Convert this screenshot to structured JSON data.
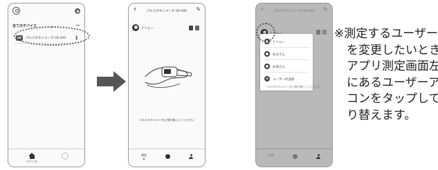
{
  "screen1": {
    "all_devices_label": "全てのデバイス",
    "device_name": "パルスオキシメータ OX-400",
    "bluetooth_icon": "bluetooth-icon",
    "nav": [
      {
        "label": "デバイス",
        "icon": "home-icon"
      },
      {
        "label": "",
        "icon": "user-icon"
      }
    ]
  },
  "screen2": {
    "title": "パルスオキシメータ OX-400",
    "user_name": "ドリムー",
    "instruction": "パルスオキシメータに指を挿入してください",
    "tabs": [
      {
        "label": "測定",
        "icon": "measure-icon"
      },
      {
        "label": "",
        "icon": "info-icon"
      },
      {
        "label": "",
        "icon": "person-icon"
      }
    ]
  },
  "screen3": {
    "title": "パルスオキシメータ OX-400",
    "user_name": "ドリムー",
    "instruction": "パルスオキシメータに指を挿入してください",
    "popup_items": [
      {
        "label": "ドリムー",
        "icon": "user-icon"
      },
      {
        "label": "お父さん",
        "icon": "user-icon"
      },
      {
        "label": "お母さん",
        "icon": "user-icon"
      },
      {
        "label": "ユーザーの追加",
        "icon": "plus-icon"
      }
    ]
  },
  "note": {
    "lines": [
      "※測定するユーザー",
      "を変更したいとき",
      "アプリ測定画面左",
      "にあるユーザーア",
      "コンをタップして切",
      "り替えます。"
    ]
  }
}
